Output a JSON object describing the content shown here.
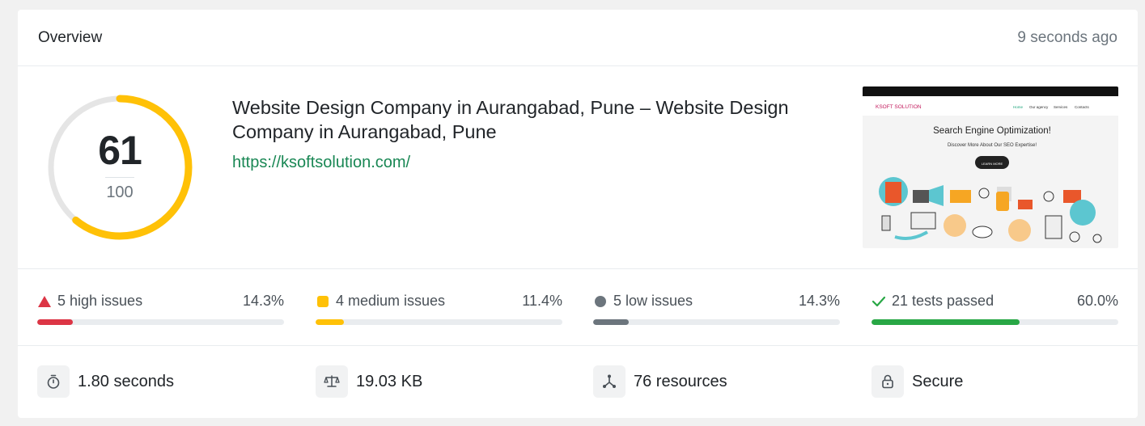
{
  "header": {
    "title": "Overview",
    "time": "9 seconds ago"
  },
  "score": {
    "value": "61",
    "max": "100",
    "fraction": 0.61,
    "color": "#ffc107"
  },
  "site": {
    "title": "Website Design Company in Aurangabad, Pune – Website Design Company in Aurangabad, Pune",
    "url": "https://ksoftsolution.com/"
  },
  "screenshot": {
    "logo": "KSOFT SOLUTION",
    "nav": [
      "Home",
      "Our agency",
      "Services",
      "Contacts"
    ],
    "heading": "Search Engine Optimization!",
    "subheading": "Discover More About Our SEO Expertise!",
    "button": "LEARN MORE"
  },
  "issues": [
    {
      "label": "5 high issues",
      "pct": "14.3%",
      "fraction": 0.143,
      "color": "#dc3545",
      "icon": "triangle-icon"
    },
    {
      "label": "4 medium issues",
      "pct": "11.4%",
      "fraction": 0.114,
      "color": "#ffc107",
      "icon": "square-icon"
    },
    {
      "label": "5 low issues",
      "pct": "14.3%",
      "fraction": 0.143,
      "color": "#6c757d",
      "icon": "circle-icon"
    },
    {
      "label": "21 tests passed",
      "pct": "60.0%",
      "fraction": 0.6,
      "color": "#28a745",
      "icon": "check-icon"
    }
  ],
  "metrics": [
    {
      "label": "1.80 seconds",
      "icon": "stopwatch-icon"
    },
    {
      "label": "19.03 KB",
      "icon": "scale-icon"
    },
    {
      "label": "76 resources",
      "icon": "network-icon"
    },
    {
      "label": "Secure",
      "icon": "lock-icon"
    }
  ]
}
